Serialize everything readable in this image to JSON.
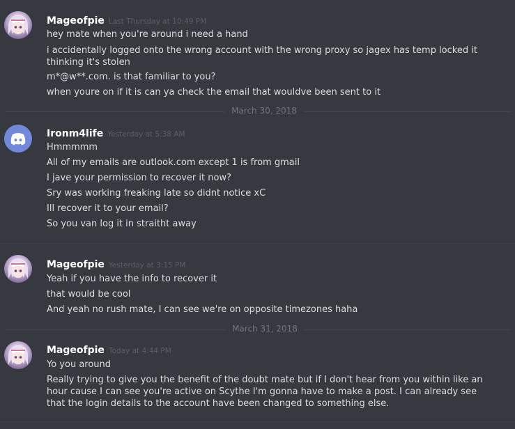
{
  "messages": [
    {
      "username": "Mageofpie",
      "timestamp": "Last Thursday at 10:49 PM",
      "avatar": "anime-character-avatar",
      "lines": [
        "hey mate when you're around i need a hand",
        "i accidentally logged onto the wrong account with the wrong proxy so jagex has temp locked it thinking it's stolen",
        "m*@w**.com. is that familiar to you?",
        "when youre on if it is can ya check the email that wouldve been sent to it"
      ]
    },
    {
      "username": "Ironm4life",
      "timestamp": "Yesterday at 5:38 AM",
      "avatar": "discord-logo-avatar",
      "lines": [
        "Hmmmmm",
        "All of my emails are outlook.com except 1 is from gmail",
        "I jave your permission to recover it now?",
        "Sry was working freaking late so didnt notice xC",
        "Ill recover it to your email?",
        "So you van log it in straitht away"
      ]
    },
    {
      "username": "Mageofpie",
      "timestamp": "Yesterday at 3:15 PM",
      "avatar": "anime-character-avatar",
      "lines": [
        "Yeah if you have the info to recover it",
        "that would be cool",
        "And yeah no rush mate, I can see we're on opposite timezones haha"
      ]
    },
    {
      "username": "Mageofpie",
      "timestamp": "Today at 4:44 PM",
      "avatar": "anime-character-avatar",
      "lines": [
        "Yo you around",
        "Really trying to give you the benefit of the doubt mate but if I don't hear from you within like an hour cause I can see you're active on Scythe I'm gonna have to make a post. I can already see that the login details to the account have been changed to something else."
      ]
    }
  ],
  "dividers": [
    "March 30, 2018",
    "March 31, 2018"
  ],
  "colors": {
    "background": "#36393f",
    "username": "#ffffff",
    "message_text": "#dcddde",
    "timestamp": "#5c5f66",
    "divider_text": "#72767d",
    "discord_blurple": "#7289da"
  }
}
